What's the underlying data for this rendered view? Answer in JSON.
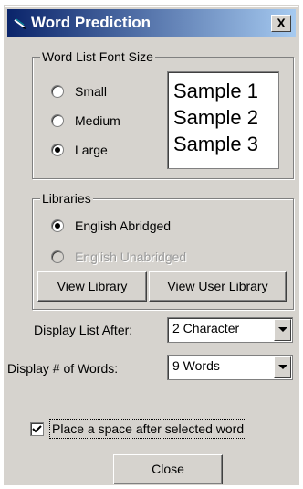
{
  "window": {
    "title": "Word Prediction",
    "close_label": "X",
    "title_icon": "pen-icon"
  },
  "font_size_group": {
    "legend": "Word List Font Size",
    "options": [
      {
        "label": "Small",
        "selected": false
      },
      {
        "label": "Medium",
        "selected": false
      },
      {
        "label": "Large",
        "selected": true
      }
    ],
    "samples": [
      "Sample 1",
      "Sample 2",
      "Sample 3"
    ]
  },
  "libraries_group": {
    "legend": "Libraries",
    "options": [
      {
        "label": "English Abridged",
        "selected": true,
        "enabled": true
      },
      {
        "label": "English Unabridged",
        "selected": false,
        "enabled": false
      }
    ],
    "view_library_label": "View Library",
    "view_user_library_label": "View User Library"
  },
  "display_list_after": {
    "label": "Display  List After:",
    "value": "2 Character"
  },
  "display_words": {
    "label": "Display # of Words:",
    "value": "9 Words"
  },
  "space_after": {
    "label": "Place a space after selected word",
    "checked": true
  },
  "close_button_label": "Close"
}
